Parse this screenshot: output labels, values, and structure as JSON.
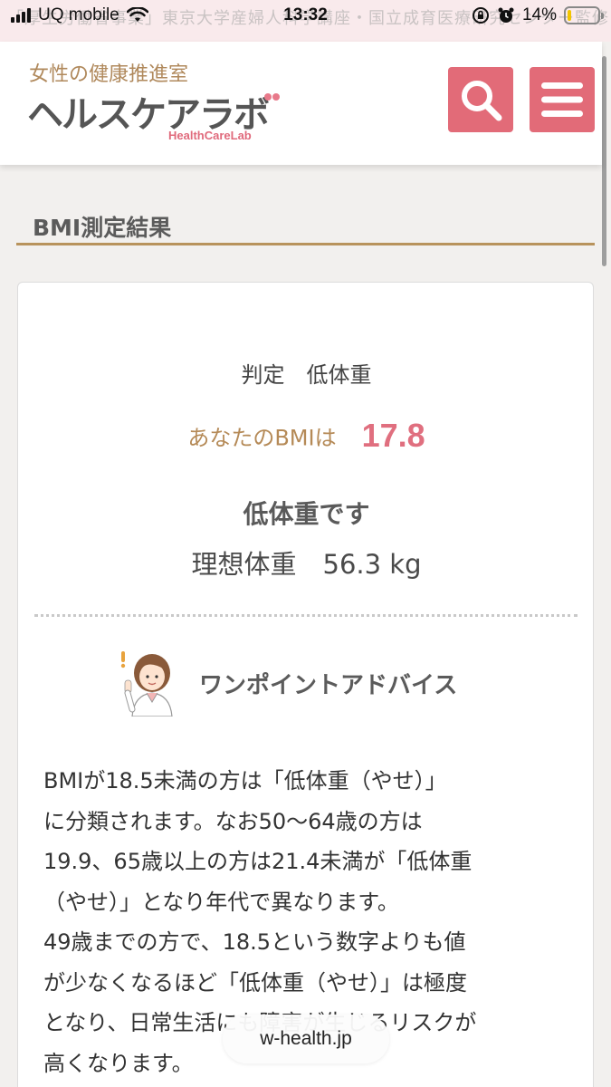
{
  "status_bar": {
    "ticker": "「厚生労働省事業」東京大学産婦人科学講座・国立成育医療研究センター監修",
    "carrier": "UQ mobile",
    "time": "13:32",
    "battery": "14%",
    "battery_level": 0.14,
    "icons": [
      "signal-icon",
      "wifi-icon",
      "lock-rotation-icon",
      "alarm-icon",
      "battery-icon"
    ]
  },
  "header": {
    "logo_subtitle": "女性の健康推進室",
    "logo_title": "ヘルスケアラボ",
    "logo_en": "HealthCareLab",
    "accent_color": "#e26b78"
  },
  "section": {
    "title": "BMI測定結果"
  },
  "result": {
    "judgement": "判定　低体重",
    "bmi_label": "あなたのBMIは",
    "bmi_value": "17.8",
    "category": "低体重です",
    "ideal_weight": "理想体重　56.3 kg"
  },
  "advice": {
    "title": "ワンポイントアドバイス",
    "lines": [
      "BMIが18.5未満の方は「低体重（やせ）」",
      "に分類されます。なお50〜64歳の方は",
      "19.9、65歳以上の方は21.4未満が「低体重",
      "（やせ）」となり年代で異なります。",
      "49歳までの方で、18.5という数字よりも値",
      "が少なくなるほど「低体重（やせ）」は極度",
      "となり、日常生活にも障害が生じるリスクが",
      "高くなります。"
    ]
  },
  "browser": {
    "url": "w-health.jp"
  }
}
